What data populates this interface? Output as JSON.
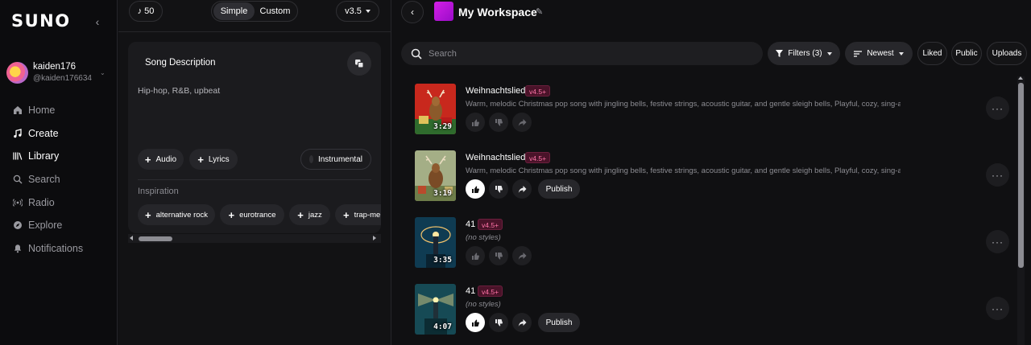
{
  "sidebar": {
    "logo": "SUNO",
    "user": {
      "name": "kaiden176",
      "handle": "@kaiden176634"
    },
    "nav": [
      {
        "label": "Home",
        "icon": "home-icon"
      },
      {
        "label": "Create",
        "icon": "create-icon",
        "active": true
      },
      {
        "label": "Library",
        "icon": "library-icon"
      },
      {
        "label": "Search",
        "icon": "search-icon"
      },
      {
        "label": "Radio",
        "icon": "radio-icon"
      },
      {
        "label": "Explore",
        "icon": "explore-icon"
      },
      {
        "label": "Notifications",
        "icon": "bell-icon"
      }
    ]
  },
  "create": {
    "credits": "50",
    "mode_simple": "Simple",
    "mode_custom": "Custom",
    "version": "v3.5",
    "song_description_label": "Song Description",
    "description_value": "Hip-hop, R&B, upbeat",
    "audio_label": "Audio",
    "lyrics_label": "Lyrics",
    "instrumental_label": "Instrumental",
    "inspiration_label": "Inspiration",
    "inspiration_tags": [
      "alternative rock",
      "eurotrance",
      "jazz",
      "trap-me"
    ]
  },
  "workspace": {
    "title": "My Workspace",
    "search_placeholder": "Search",
    "filters_label": "Filters (3)",
    "sort_label": "Newest",
    "liked_label": "Liked",
    "public_label": "Public",
    "uploads_label": "Uploads",
    "publish_label": "Publish",
    "songs": [
      {
        "title": "Weihnachtslied",
        "badge": "v4.5+",
        "description": "Warm, melodic Christmas pop song with jingling bells, festive strings, acoustic guitar, and gentle sleigh bells, Playful, cozy, sing-along atmos...",
        "duration": "3:29",
        "liked": false,
        "published": true,
        "cover": "reindeer-red"
      },
      {
        "title": "Weihnachtslied",
        "badge": "v4.5+",
        "description": "Warm, melodic Christmas pop song with jingling bells, festive strings, acoustic guitar, and gentle sleigh bells, Playful, cozy, sing-along atmos...",
        "duration": "3:19",
        "liked": true,
        "published": false,
        "cover": "reindeer-green"
      },
      {
        "title": "41",
        "badge": "v4.5+",
        "description": "(no styles)",
        "duration": "3:35",
        "liked": false,
        "published": true,
        "cover": "lighthouse-blue"
      },
      {
        "title": "41",
        "badge": "v4.5+",
        "description": "(no styles)",
        "duration": "4:07",
        "liked": true,
        "published": false,
        "cover": "lighthouse-teal"
      }
    ]
  },
  "colors": {
    "background": "#101012",
    "sidebar": "#0c0c0e",
    "badge_bg": "#4a1329",
    "badge_text": "#ff74a8",
    "workspace_thumb": "#d41fe6"
  }
}
